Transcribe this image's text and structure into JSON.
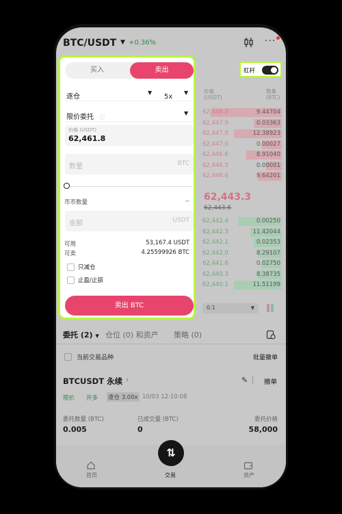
{
  "header": {
    "pair": "BTC/USDT",
    "change": "+0.36%",
    "candle_icon": "candlestick-icon",
    "more_icon": "more-icon"
  },
  "leverage": {
    "label": "杠杆",
    "enabled": true
  },
  "panel": {
    "tabs": {
      "buy": "买入",
      "sell": "卖出",
      "active": "sell"
    },
    "margin_mode": "逐仓",
    "leverage_value": "5x",
    "order_type": "限价委托",
    "price_label": "价格 (USDT)",
    "price_value": "62,461.8",
    "qty_placeholder": "数量",
    "qty_unit": "BTC",
    "slider_level": 0,
    "coin_qty_label": "币币数量",
    "coin_qty_value": "--",
    "amount_placeholder": "金额",
    "amount_unit": "USDT",
    "available_label": "可用",
    "available_value": "53,167.4 USDT",
    "sellable_label": "可卖",
    "sellable_value": "4.25599926 BTC",
    "reduce_only": "只减仓",
    "tpsl": "止盈/止损",
    "submit": "卖出 BTC"
  },
  "orderbook": {
    "price_header": "价格",
    "price_unit": "(USDT)",
    "qty_header": "数量",
    "qty_unit": "(BTC)",
    "asks": [
      {
        "price": "62,448.0",
        "qty": "9.44704",
        "depth": 0.9
      },
      {
        "price": "62,447.9",
        "qty": "0.03363",
        "depth": 0.35
      },
      {
        "price": "62,447.8",
        "qty": "12.38923",
        "depth": 0.6
      },
      {
        "price": "62,447.0",
        "qty": "0.00027",
        "depth": 0.25
      },
      {
        "price": "62,446.6",
        "qty": "8.91040",
        "depth": 0.45
      },
      {
        "price": "62,446.5",
        "qty": "0.00001",
        "depth": 0.2
      },
      {
        "price": "62,446.6",
        "qty": "9.64201",
        "depth": 0.3
      }
    ],
    "mid_price": "62,443.3",
    "mid_sub": "62,443.6",
    "bids": [
      {
        "price": "62,442.4",
        "qty": "0.00250",
        "depth": 0.55
      },
      {
        "price": "62,442.3",
        "qty": "11.42044",
        "depth": 0.4
      },
      {
        "price": "62,442.1",
        "qty": "0.02353",
        "depth": 0.35
      },
      {
        "price": "62,442.0",
        "qty": "8.29107",
        "depth": 0.3
      },
      {
        "price": "62,441.6",
        "qty": "0.02750",
        "depth": 0.25
      },
      {
        "price": "62,440.3",
        "qty": "8.38735",
        "depth": 0.3
      },
      {
        "price": "62,440.1",
        "qty": "11.51199",
        "depth": 0.6
      }
    ],
    "precision": "0.1"
  },
  "orders": {
    "tab_orders": "委托 (2)",
    "tab_positions": "仓位 (0) 和资产",
    "tab_strategy": "策略 (0)",
    "current_pair_only": "当前交易品种",
    "batch_cancel": "批量撤单",
    "contract_title": "BTCUSDT 永续",
    "cancel": "撤单",
    "tag_limit": "限价",
    "tag_open": "开多",
    "tag_margin": "逐仓 3.00x",
    "timestamp": "10/03 12:10:08",
    "qty_label": "委托数量 (BTC)",
    "qty_value": "0.005",
    "filled_label": "已成交量 (BTC)",
    "filled_value": "0",
    "price_label": "委托价格",
    "price_value": "58,000"
  },
  "nav": {
    "home": "首页",
    "trade": "交易",
    "assets": "资产"
  }
}
